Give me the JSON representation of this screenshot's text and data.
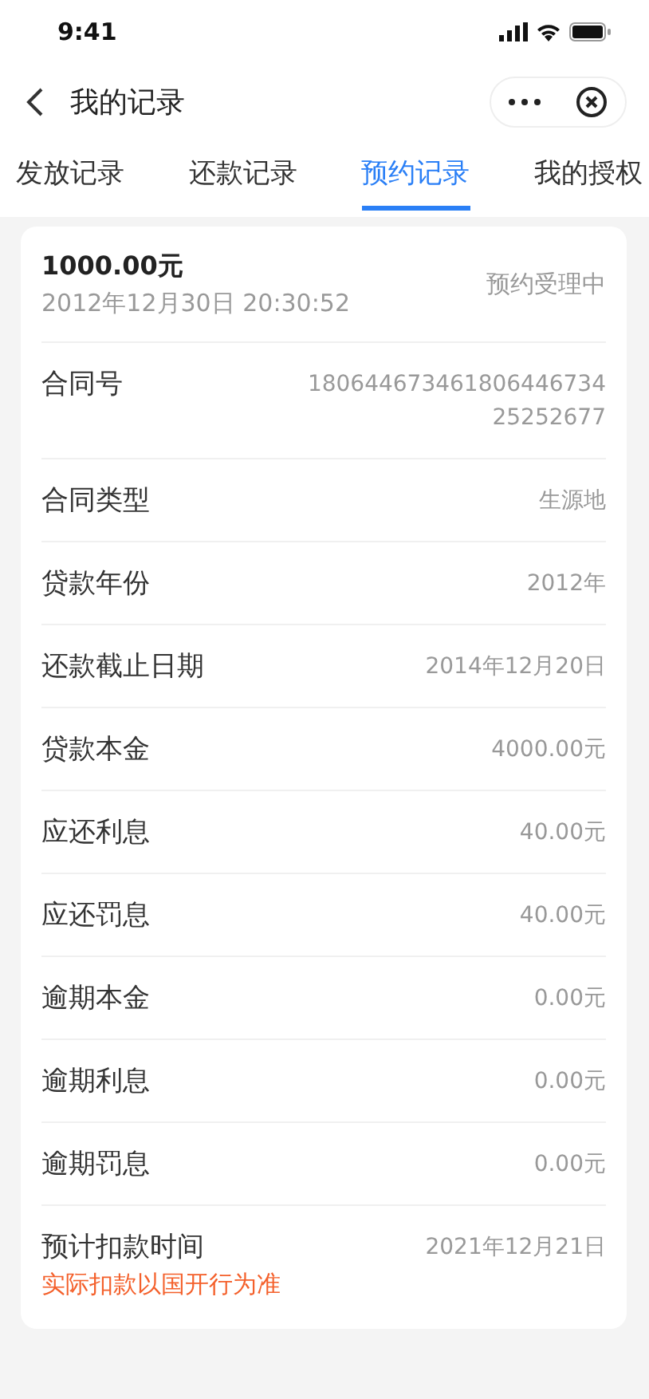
{
  "status_bar": {
    "time": "9:41"
  },
  "nav": {
    "title": "我的记录"
  },
  "tabs": [
    {
      "label": "发放记录",
      "selected": false
    },
    {
      "label": "还款记录",
      "selected": false
    },
    {
      "label": "预约记录",
      "selected": true
    },
    {
      "label": "我的授权",
      "selected": false
    }
  ],
  "record": {
    "amount": "1000.00元",
    "datetime": "2012年12月30日 20:30:52",
    "status": "预约受理中"
  },
  "fields": [
    {
      "label": "合同号",
      "value": "180644673461806446734 25252677"
    },
    {
      "label": "合同类型",
      "value": "生源地"
    },
    {
      "label": "贷款年份",
      "value": "2012年"
    },
    {
      "label": "还款截止日期",
      "value": "2014年12月20日"
    },
    {
      "label": "贷款本金",
      "value": "4000.00元"
    },
    {
      "label": "应还利息",
      "value": "40.00元"
    },
    {
      "label": "应还罚息",
      "value": "40.00元"
    },
    {
      "label": "逾期本金",
      "value": "0.00元"
    },
    {
      "label": "逾期利息",
      "value": "0.00元"
    },
    {
      "label": "逾期罚息",
      "value": "0.00元"
    },
    {
      "label": "预计扣款时间",
      "value": "2021年12月21日",
      "note": "实际扣款以国开行为准"
    }
  ]
}
